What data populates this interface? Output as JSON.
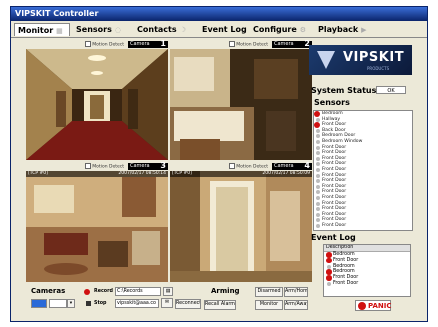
{
  "window": {
    "title": "VIPSKIT Controller"
  },
  "tabs": [
    {
      "label": "Monitor"
    },
    {
      "label": "Sensors"
    },
    {
      "label": "Contacts"
    },
    {
      "label": "Event Log"
    },
    {
      "label": "Configure"
    },
    {
      "label": "Playback"
    }
  ],
  "cameras": [
    {
      "label": "Camera",
      "number": "1",
      "motion_detect": "Motion Detect",
      "stamp_left": "",
      "stamp_right": ""
    },
    {
      "label": "Camera",
      "number": "2",
      "motion_detect": "Motion Detect",
      "stamp_left": "",
      "stamp_right": ""
    },
    {
      "label": "Camera",
      "number": "3",
      "motion_detect": "Motion Detect",
      "stamp_left": "[TCP #0]",
      "stamp_right": "2007/02/17 08:50:14"
    },
    {
      "label": "Camera",
      "number": "4",
      "motion_detect": "Motion Detect",
      "stamp_left": "[TCP #0]",
      "stamp_right": "2007/02/17 08:50:09"
    }
  ],
  "logo": {
    "text": "VIPSKIT",
    "subtitle": "PRODUCTS"
  },
  "system_status": {
    "label": "System Status",
    "value": "OK"
  },
  "sensors": {
    "title": "Sensors",
    "items": [
      {
        "label": "Bedroom",
        "alarm": true
      },
      {
        "label": "Hallway",
        "alarm": false
      },
      {
        "label": "Front Door",
        "alarm": true
      },
      {
        "label": "Back Door",
        "alarm": false
      },
      {
        "label": "Bedroom Door",
        "alarm": false
      },
      {
        "label": "Bedroom Window",
        "alarm": false
      },
      {
        "label": "Front Door",
        "alarm": false
      },
      {
        "label": "Front Door",
        "alarm": false
      },
      {
        "label": "Front Door",
        "alarm": false
      },
      {
        "label": "Front Door",
        "alarm": false
      },
      {
        "label": "Front Door",
        "alarm": false
      },
      {
        "label": "Front Door",
        "alarm": false
      },
      {
        "label": "Front Door",
        "alarm": false
      },
      {
        "label": "Front Door",
        "alarm": false
      },
      {
        "label": "Front Door",
        "alarm": false
      },
      {
        "label": "Front Door",
        "alarm": false
      },
      {
        "label": "Front Door",
        "alarm": false
      },
      {
        "label": "Front Door",
        "alarm": false
      },
      {
        "label": "Front Door",
        "alarm": false
      },
      {
        "label": "Front Door",
        "alarm": false
      },
      {
        "label": "Front Door",
        "alarm": false
      }
    ]
  },
  "event_log": {
    "title": "Event Log",
    "header": "Description",
    "items": [
      {
        "label": "Bedroom",
        "alarm": true
      },
      {
        "label": "Front Door",
        "alarm": true
      },
      {
        "label": "Bedroom",
        "alarm": false
      },
      {
        "label": "Bedroom",
        "alarm": true
      },
      {
        "label": "Front Door",
        "alarm": true
      },
      {
        "label": "Front Door",
        "alarm": false
      }
    ]
  },
  "panic_label": "PANIC",
  "cameras_section": {
    "title": "Cameras",
    "record_label": "Record",
    "record_path": "C:\\Records",
    "stop_label": "Stop",
    "email": "vipsskit@aaa.co",
    "reconnect_label": "Reconnect"
  },
  "arming": {
    "title": "Arming",
    "buttons": [
      "Disarmed",
      "Arm/Home",
      "Recall Alarm",
      "Monitor",
      "Arm/Away"
    ]
  }
}
